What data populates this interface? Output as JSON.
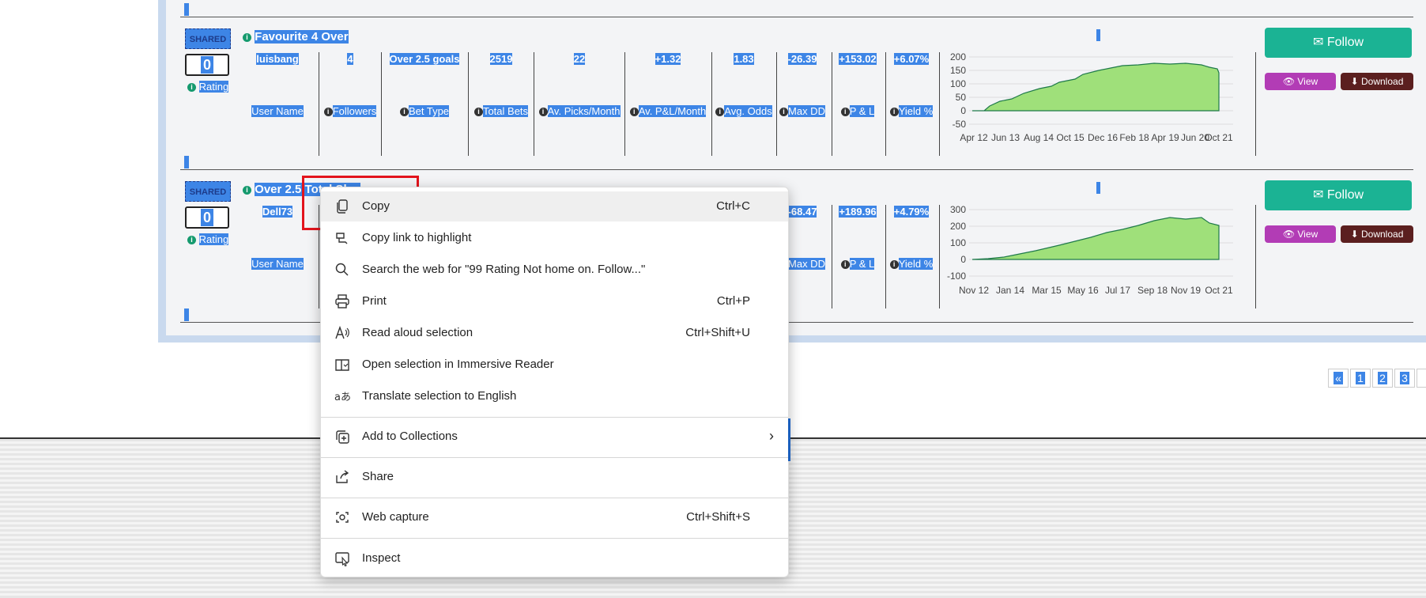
{
  "rows": [
    {
      "badge": "SHARED",
      "rating_value": "0",
      "rating_label": "Rating",
      "title": "Favourite 4 Over",
      "values": [
        "luisbang",
        "4",
        "Over 2.5 goals",
        "2519",
        "22",
        "+1.32",
        "1.83",
        "-26.39",
        "+153.02",
        "+6.07%"
      ],
      "labels": [
        "User Name",
        "Followers",
        "Bet Type",
        "Total Bets",
        "Av. Picks/Month",
        "Av. P&L/Month",
        "Avg. Odds",
        "Max DD",
        "P & L",
        "Yield %"
      ],
      "chart": {
        "y_ticks": [
          "200",
          "150",
          "100",
          "50",
          "0",
          "-50"
        ],
        "x_ticks": [
          "Apr 12",
          "Jun 13",
          "Aug 14",
          "Oct 15",
          "Dec 16",
          "Feb 18",
          "Apr 19",
          "Jun 20",
          "Oct 21"
        ]
      },
      "follow": "Follow",
      "view": "View",
      "download": "Download"
    },
    {
      "badge": "SHARED",
      "rating_value": "0",
      "rating_label": "Rating",
      "title": "Over 2.5 Total Sh...",
      "values": [
        "Dell73",
        "",
        "",
        "",
        "",
        "",
        "",
        "-68.47",
        "+189.96",
        "+4.79%"
      ],
      "labels": [
        "User Name",
        "",
        "",
        "",
        "",
        "",
        "",
        "Max DD",
        "P & L",
        "Yield %"
      ],
      "chart": {
        "y_ticks": [
          "300",
          "200",
          "100",
          "0",
          "-100"
        ],
        "x_ticks": [
          "Nov 12",
          "Jan 14",
          "Mar 15",
          "May 16",
          "Jul 17",
          "Sep 18",
          "Nov 19",
          "Oct 21"
        ]
      },
      "follow": "Follow",
      "view": "View",
      "download": "Download"
    }
  ],
  "pagination": [
    "«",
    "1",
    "2",
    "3"
  ],
  "context_menu": {
    "items": [
      {
        "label": "Copy",
        "shortcut": "Ctrl+C",
        "icon": "copy-icon"
      },
      {
        "label": "Copy link to highlight",
        "shortcut": "",
        "icon": "link-highlight-icon"
      },
      {
        "label": "Search the web for \"99  Rating  Not home on.    Follow...\"",
        "shortcut": "",
        "icon": "search-icon"
      },
      {
        "label": "Print",
        "shortcut": "Ctrl+P",
        "icon": "print-icon"
      },
      {
        "label": "Read aloud selection",
        "shortcut": "Ctrl+Shift+U",
        "icon": "read-aloud-icon"
      },
      {
        "label": "Open selection in Immersive Reader",
        "shortcut": "",
        "icon": "immersive-reader-icon"
      },
      {
        "label": "Translate selection to English",
        "shortcut": "",
        "icon": "translate-icon"
      },
      {
        "label": "Add to Collections",
        "shortcut": "",
        "icon": "collections-icon"
      },
      {
        "label": "Share",
        "shortcut": "",
        "icon": "share-icon"
      },
      {
        "label": "Web capture",
        "shortcut": "Ctrl+Shift+S",
        "icon": "web-capture-icon"
      },
      {
        "label": "Inspect",
        "shortcut": "",
        "icon": "inspect-icon"
      }
    ]
  }
}
